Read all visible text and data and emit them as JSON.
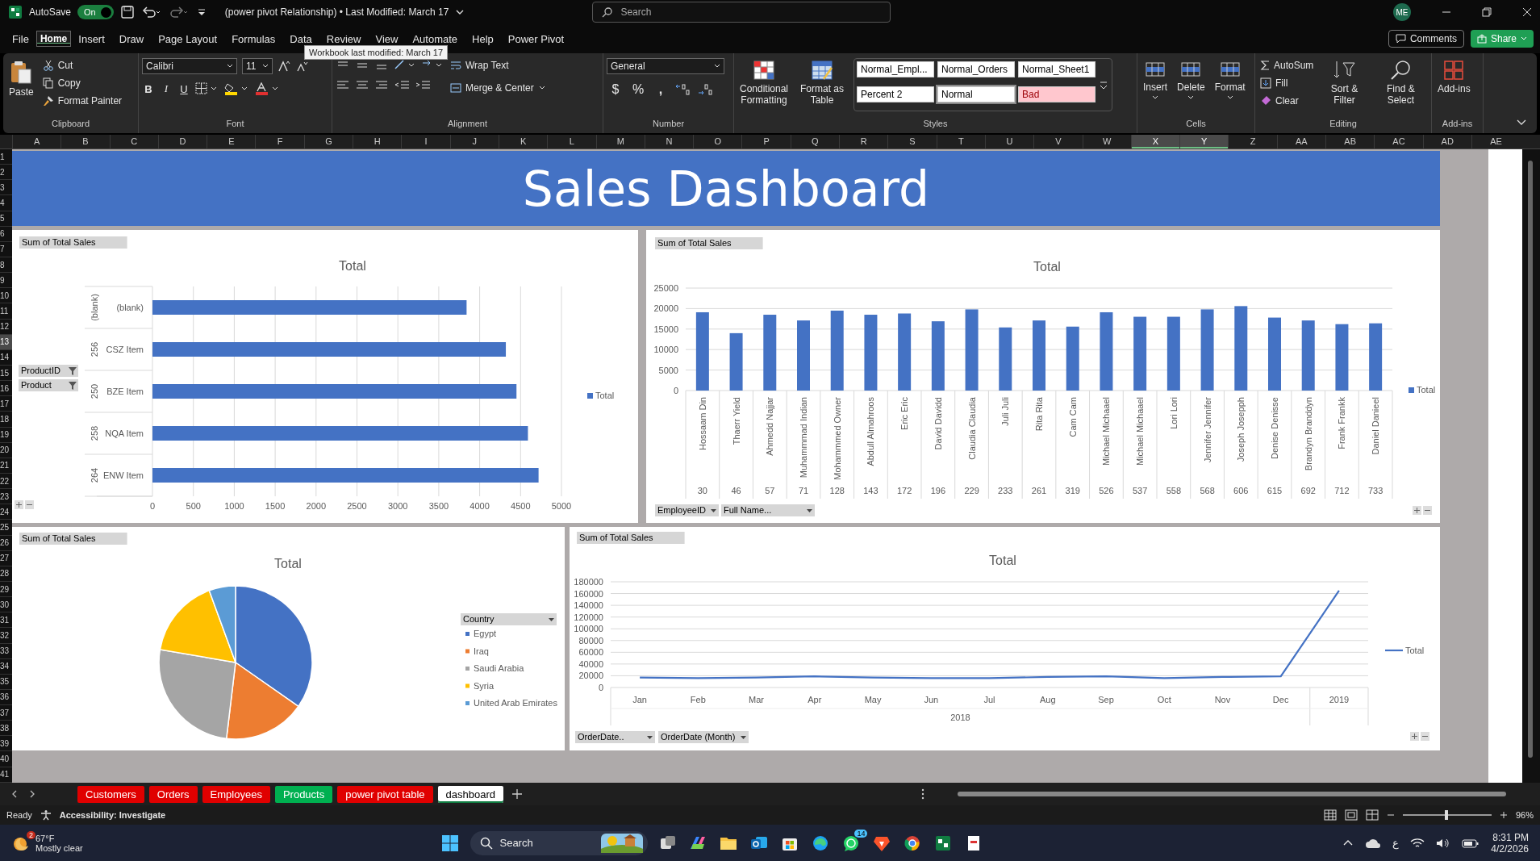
{
  "title_bar": {
    "autosave_label": "AutoSave",
    "autosave": {
      "on": true,
      "label": "On"
    },
    "title": "(power pivot Relationship) • Last Modified: March 17",
    "search": {
      "placeholder": "Search"
    },
    "avatar": "ME"
  },
  "tooltip": "Workbook last modified: March 17",
  "menu_tabs": [
    {
      "label": "File",
      "selected": false
    },
    {
      "label": "Home",
      "selected": true
    },
    {
      "label": "Insert",
      "selected": false
    },
    {
      "label": "Draw",
      "selected": false
    },
    {
      "label": "Page Layout",
      "selected": false
    },
    {
      "label": "Formulas",
      "selected": false
    },
    {
      "label": "Data",
      "selected": false
    },
    {
      "label": "Review",
      "selected": false
    },
    {
      "label": "View",
      "selected": false
    },
    {
      "label": "Automate",
      "selected": false
    },
    {
      "label": "Help",
      "selected": false
    },
    {
      "label": "Power Pivot",
      "selected": false
    }
  ],
  "comments": "Comments",
  "share": "Share",
  "ribbon": {
    "clipboard": {
      "label": "Clipboard",
      "paste": "Paste",
      "cut": "Cut",
      "copy": "Copy",
      "format_painter": "Format Painter"
    },
    "font": {
      "label": "Font",
      "family": "Calibri",
      "size": "11",
      "bold": "B",
      "italic": "I",
      "underline": "U"
    },
    "alignment": {
      "label": "Alignment",
      "wrap_text": "Wrap Text",
      "merge_center": "Merge & Center"
    },
    "number": {
      "label": "Number",
      "format": "General",
      "currency": "$",
      "percent": "%",
      "comma": ","
    },
    "styles": {
      "label": "Styles",
      "conditional_formatting": "Conditional Formatting",
      "format_as_table": "Format as Table",
      "cell_styles": [
        {
          "label": "Normal_Empl...",
          "kind": "normal",
          "selected": false
        },
        {
          "label": "Normal_Orders",
          "kind": "normal",
          "selected": false
        },
        {
          "label": "Normal_Sheet1",
          "kind": "normal",
          "selected": false
        },
        {
          "label": "Percent 2",
          "kind": "normal",
          "selected": false
        },
        {
          "label": "Normal",
          "kind": "normal",
          "selected": true
        },
        {
          "label": "Bad",
          "kind": "bad",
          "selected": false
        }
      ]
    },
    "cells": {
      "label": "Cells",
      "buttons": [
        "Insert",
        "Delete",
        "Format"
      ]
    },
    "editing": {
      "label": "Editing",
      "autosum": "AutoSum",
      "fill": "Fill",
      "clear": "Clear",
      "sort_filter": "Sort & Filter",
      "find_select": "Find & Select"
    },
    "addins": {
      "label": "Add-ins",
      "button": "Add-ins"
    }
  },
  "columns": [
    {
      "label": "A",
      "selected": false
    },
    {
      "label": "B",
      "selected": false
    },
    {
      "label": "C",
      "selected": false
    },
    {
      "label": "D",
      "selected": false
    },
    {
      "label": "E",
      "selected": false
    },
    {
      "label": "F",
      "selected": false
    },
    {
      "label": "G",
      "selected": false
    },
    {
      "label": "H",
      "selected": false
    },
    {
      "label": "I",
      "selected": false
    },
    {
      "label": "J",
      "selected": false
    },
    {
      "label": "K",
      "selected": false
    },
    {
      "label": "L",
      "selected": false
    },
    {
      "label": "M",
      "selected": false
    },
    {
      "label": "N",
      "selected": false
    },
    {
      "label": "O",
      "selected": false
    },
    {
      "label": "P",
      "selected": false
    },
    {
      "label": "Q",
      "selected": false
    },
    {
      "label": "R",
      "selected": false
    },
    {
      "label": "S",
      "selected": false
    },
    {
      "label": "T",
      "selected": false
    },
    {
      "label": "U",
      "selected": false
    },
    {
      "label": "V",
      "selected": false
    },
    {
      "label": "W",
      "selected": false
    },
    {
      "label": "X",
      "selected": true
    },
    {
      "label": "Y",
      "selected": true
    },
    {
      "label": "Z",
      "selected": false
    },
    {
      "label": "AA",
      "selected": false
    },
    {
      "label": "AB",
      "selected": false
    },
    {
      "label": "AC",
      "selected": false
    },
    {
      "label": "AD",
      "selected": false
    },
    {
      "label": "AE",
      "selected": false
    }
  ],
  "rows": [
    {
      "label": "1",
      "selected": false
    },
    {
      "label": "2",
      "selected": false
    },
    {
      "label": "3",
      "selected": false
    },
    {
      "label": "4",
      "selected": false
    },
    {
      "label": "5",
      "selected": false
    },
    {
      "label": "6",
      "selected": false
    },
    {
      "label": "7",
      "selected": false
    },
    {
      "label": "8",
      "selected": false
    },
    {
      "label": "9",
      "selected": false
    },
    {
      "label": "10",
      "selected": false
    },
    {
      "label": "11",
      "selected": false
    },
    {
      "label": "12",
      "selected": false
    },
    {
      "label": "13",
      "selected": true
    },
    {
      "label": "14",
      "selected": false
    },
    {
      "label": "15",
      "selected": false
    },
    {
      "label": "16",
      "selected": false
    },
    {
      "label": "17",
      "selected": false
    },
    {
      "label": "18",
      "selected": false
    },
    {
      "label": "19",
      "selected": false
    },
    {
      "label": "20",
      "selected": false
    },
    {
      "label": "21",
      "selected": false
    },
    {
      "label": "22",
      "selected": false
    },
    {
      "label": "23",
      "selected": false
    },
    {
      "label": "24",
      "selected": false
    },
    {
      "label": "25",
      "selected": false
    },
    {
      "label": "26",
      "selected": false
    },
    {
      "label": "27",
      "selected": false
    },
    {
      "label": "28",
      "selected": false
    },
    {
      "label": "29",
      "selected": false
    },
    {
      "label": "30",
      "selected": false
    },
    {
      "label": "31",
      "selected": false
    },
    {
      "label": "32",
      "selected": false
    },
    {
      "label": "33",
      "selected": false
    },
    {
      "label": "34",
      "selected": false
    },
    {
      "label": "35",
      "selected": false
    },
    {
      "label": "36",
      "selected": false
    },
    {
      "label": "37",
      "selected": false
    },
    {
      "label": "38",
      "selected": false
    },
    {
      "label": "39",
      "selected": false
    },
    {
      "label": "40",
      "selected": false
    },
    {
      "label": "41",
      "selected": false
    }
  ],
  "dashboard": {
    "title": "Sales Dashboard",
    "charts": [
      {
        "value_button": "Sum of Total Sales",
        "field_buttons": [
          {
            "label": "ProductID",
            "kind": "filter"
          },
          {
            "label": "Product",
            "kind": "filter"
          }
        ],
        "id_labels": [
          "(blank)",
          "256",
          "250",
          "258",
          "264"
        ],
        "chart_data": {
          "type": "bar",
          "orientation": "horizontal",
          "title": "Total",
          "categories": [
            "(blank)",
            "CSZ Item",
            "BZE Item",
            "NQA Item",
            "ENW Item"
          ],
          "grid": true,
          "legend": "right",
          "series": [
            {
              "name": "Total",
              "color": "#4472c4",
              "values": [
                3840,
                4320,
                4450,
                4590,
                4720
              ]
            }
          ],
          "xlim": [
            0,
            5000
          ],
          "xticks": [
            0,
            500,
            1000,
            1500,
            2000,
            2500,
            3000,
            3500,
            4000,
            4500,
            5000
          ]
        }
      },
      {
        "value_button": "Sum of Total Sales",
        "field_buttons": [
          {
            "label": "EmployeeID",
            "kind": "dropdown"
          },
          {
            "label": "Full Name...",
            "kind": "dropdown"
          }
        ],
        "id_labels": [
          "30",
          "46",
          "57",
          "71",
          "128",
          "143",
          "172",
          "196",
          "229",
          "233",
          "261",
          "319",
          "526",
          "537",
          "558",
          "568",
          "606",
          "615",
          "692",
          "712",
          "733"
        ],
        "chart_data": {
          "type": "bar",
          "orientation": "vertical",
          "title": "Total",
          "grid": true,
          "legend": "right",
          "categories": [
            "Hossaam Din",
            "Thaerr Yield",
            "Ahmedd Najjar",
            "Muhammmad Indian",
            "Mohammmed Owner",
            "Abdull Almahroos",
            "Eric Eric",
            "David Davidd",
            "Claudia Claudia",
            "Juli Juli",
            "Rita Rita",
            "Cam Cam",
            "Michael Michaael",
            "Michael Michaael",
            "Lori Lori",
            "Jennifer Jennifer",
            "Joseph Josepph",
            "Denise Denisse",
            "Brandyn Branddyn",
            "Frank Frankk",
            "Daniel Danieel"
          ],
          "series": [
            {
              "name": "Total",
              "color": "#4472c4",
              "values": [
                19100,
                14000,
                18500,
                17100,
                19500,
                18500,
                18800,
                16900,
                19800,
                15400,
                17100,
                15600,
                19100,
                18000,
                18000,
                19800,
                20600,
                17800,
                17100,
                16200,
                16400
              ]
            }
          ],
          "ylim": [
            0,
            25000
          ],
          "yticks": [
            0,
            5000,
            10000,
            15000,
            20000,
            25000
          ]
        }
      },
      {
        "value_button": "Sum of Total Sales",
        "field_buttons": [
          {
            "label": "Country",
            "kind": "dropdown"
          }
        ],
        "chart_data": {
          "type": "pie",
          "title": "Total",
          "legend": "right",
          "categories": [
            "Egypt",
            "Iraq",
            "Saudi Arabia",
            "Syria",
            "United Arab Emirates"
          ],
          "colors": [
            "#4472c4",
            "#ed7d31",
            "#a5a5a5",
            "#ffc000",
            "#5b9bd5"
          ],
          "series": [
            {
              "values": [
                34.7,
                17.2,
                25.8,
                16.7,
                5.6
              ]
            }
          ]
        }
      },
      {
        "value_button": "Sum of Total Sales",
        "field_buttons": [
          {
            "label": "OrderDate..",
            "kind": "dropdown"
          },
          {
            "label": "OrderDate (Month)",
            "kind": "dropdown"
          }
        ],
        "year_labels": [
          "2018"
        ],
        "chart_data": {
          "type": "line",
          "title": "Total",
          "grid": true,
          "legend": "right",
          "categories": [
            "Jan",
            "Feb",
            "Mar",
            "Apr",
            "May",
            "Jun",
            "Jul",
            "Aug",
            "Sep",
            "Oct",
            "Nov",
            "Dec",
            "2019"
          ],
          "series": [
            {
              "name": "Total",
              "color": "#4472c4",
              "values": [
                17000,
                16000,
                17000,
                19000,
                17000,
                16000,
                16000,
                18000,
                19000,
                16000,
                18000,
                19000,
                165000
              ]
            }
          ],
          "ylim": [
            0,
            180000
          ],
          "yticks": [
            0,
            20000,
            40000,
            60000,
            80000,
            100000,
            120000,
            140000,
            160000,
            180000
          ]
        }
      }
    ]
  },
  "sheet_tabs": [
    {
      "label": "Customers",
      "color": "#e00000",
      "selected": false
    },
    {
      "label": "Orders",
      "color": "#e00000",
      "selected": false
    },
    {
      "label": "Employees",
      "color": "#e00000",
      "selected": false
    },
    {
      "label": "Products",
      "color": "#00b050",
      "selected": false
    },
    {
      "label": "power pivot table",
      "color": "#e00000",
      "selected": false
    },
    {
      "label": "dashboard",
      "color": "#ffffff",
      "selected": true
    }
  ],
  "status_bar": {
    "ready": "Ready",
    "accessibility": "Accessibility: Investigate",
    "zoom": "96%",
    "zoom_slider": {
      "level": 0.49
    }
  },
  "taskbar": {
    "weather": {
      "temp": "67°F",
      "condition": "Mostly clear",
      "badge": "2"
    },
    "search": {
      "placeholder": "Search"
    },
    "whatsapp_badge": "14",
    "language": "ع",
    "time": "8:31 PM",
    "date": "4/2/2026"
  }
}
